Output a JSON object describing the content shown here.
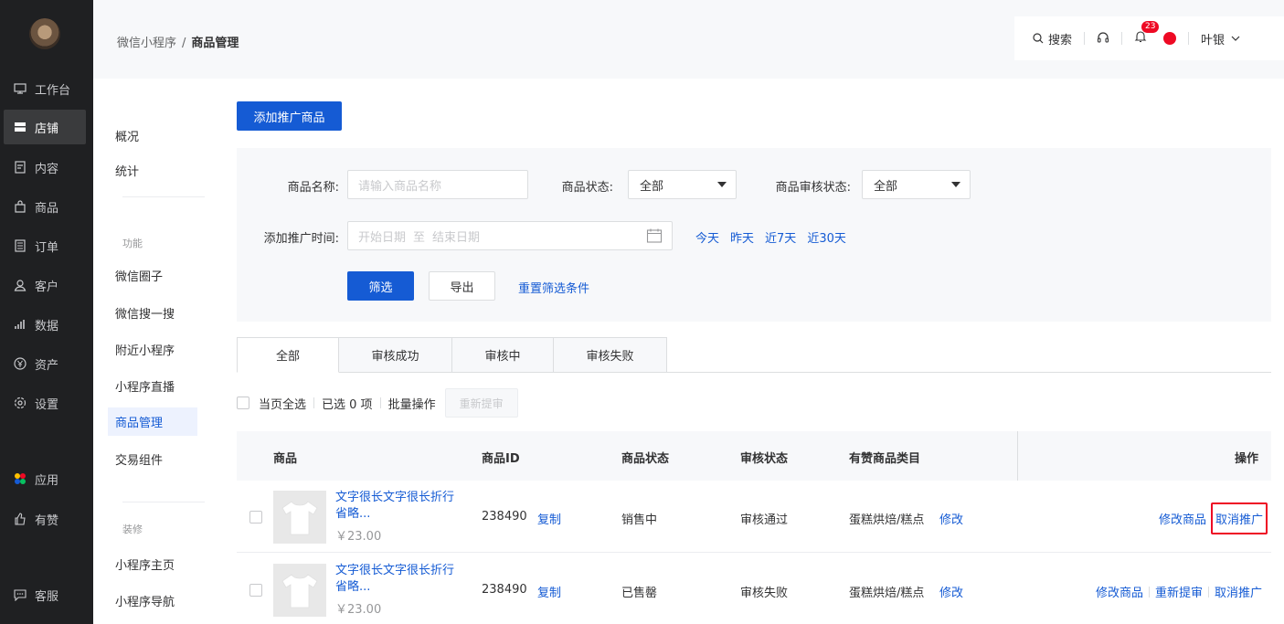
{
  "nav": {
    "items": [
      {
        "label": "工作台",
        "icon": "monitor-icon"
      },
      {
        "label": "店铺",
        "icon": "store-icon"
      },
      {
        "label": "内容",
        "icon": "document-icon"
      },
      {
        "label": "商品",
        "icon": "bag-icon"
      },
      {
        "label": "订单",
        "icon": "list-icon"
      },
      {
        "label": "客户",
        "icon": "user-icon"
      },
      {
        "label": "数据",
        "icon": "bar-chart-icon"
      },
      {
        "label": "资产",
        "icon": "yen-icon"
      },
      {
        "label": "设置",
        "icon": "gear-icon"
      },
      {
        "label": "应用",
        "icon": "apps-icon"
      },
      {
        "label": "有赞",
        "icon": "thumb-up-icon"
      },
      {
        "label": "客服",
        "icon": "chat-icon"
      }
    ],
    "active_index": 1
  },
  "header": {
    "breadcrumb_parent": "微信小程序",
    "breadcrumb_sep": "/",
    "breadcrumb_current": "商品管理",
    "search_label": "搜索",
    "notification_count": "23",
    "user_name": "叶银"
  },
  "subnav": {
    "items_top": [
      "概况",
      "统计"
    ],
    "group_function": "功能",
    "items_function": [
      "微信圈子",
      "微信搜一搜",
      "附近小程序",
      "小程序直播",
      "商品管理",
      "交易组件"
    ],
    "active": "商品管理",
    "group_decoration": "装修",
    "items_decoration": [
      "小程序主页",
      "小程序导航"
    ]
  },
  "main": {
    "add_button": "添加推广商品",
    "filter": {
      "name_label": "商品名称:",
      "name_placeholder": "请输入商品名称",
      "status_label": "商品状态:",
      "status_value": "全部",
      "audit_label": "商品审核状态:",
      "audit_value": "全部",
      "time_label": "添加推广时间:",
      "start_placeholder": "开始日期",
      "to": "至",
      "end_placeholder": "结束日期",
      "quick": [
        "今天",
        "昨天",
        "近7天",
        "近30天"
      ],
      "filter_button": "筛选",
      "export_button": "导出",
      "reset_link": "重置筛选条件"
    },
    "tabs": [
      "全部",
      "审核成功",
      "审核中",
      "审核失败"
    ],
    "active_tab": 0,
    "batch": {
      "select_page": "当页全选",
      "selected": "已选 0 项",
      "batch_ops": "批量操作",
      "resubmit": "重新提审"
    },
    "table": {
      "headers": [
        "商品",
        "商品ID",
        "商品状态",
        "审核状态",
        "有赞商品类目",
        "操作"
      ],
      "rows": [
        {
          "name": "文字很长文字很长折行省略...",
          "price": "￥23.00",
          "id": "238490",
          "copy": "复制",
          "status": "销售中",
          "audit": "审核通过",
          "category": "蛋糕烘焙/糕点",
          "edit": "修改",
          "ops": [
            "修改商品",
            "取消推广"
          ]
        },
        {
          "name": "文字很长文字很长折行省略...",
          "price": "￥23.00",
          "id": "238490",
          "copy": "复制",
          "status": "已售罄",
          "audit": "审核失败",
          "category": "蛋糕烘焙/糕点",
          "edit": "修改",
          "ops": [
            "修改商品",
            "重新提审",
            "取消推广"
          ]
        }
      ]
    }
  }
}
